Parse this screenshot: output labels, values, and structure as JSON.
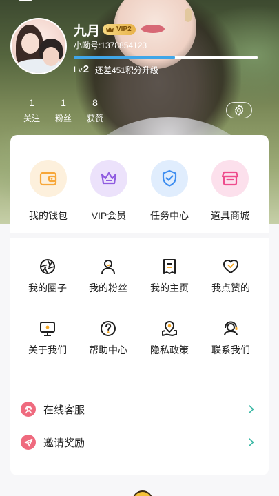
{
  "profile": {
    "username": "九月",
    "vip_label": "VIP2",
    "uid_text": "小呦号:1378854123",
    "level_prefix": "Lv",
    "level_number": "2",
    "level_progress": 0.55,
    "level_need_text": "还差451积分升级"
  },
  "stats": [
    {
      "value": "1",
      "label": "关注"
    },
    {
      "value": "1",
      "label": "粉丝"
    },
    {
      "value": "8",
      "label": "获赞"
    }
  ],
  "quick_actions": [
    {
      "label": "我的钱包",
      "icon": "wallet-icon",
      "color": "#f7a739",
      "bg": "#fdf0dc"
    },
    {
      "label": "VIP会员",
      "icon": "crown-icon",
      "color": "#8f5be0",
      "bg": "#ece2fb"
    },
    {
      "label": "任务中心",
      "icon": "shield-check-icon",
      "color": "#3f8ef0",
      "bg": "#e0edfd"
    },
    {
      "label": "道具商城",
      "icon": "store-icon",
      "color": "#ee4b8c",
      "bg": "#fce0ec"
    }
  ],
  "grid_items": [
    {
      "label": "我的圈子",
      "icon": "aperture-icon"
    },
    {
      "label": "我的粉丝",
      "icon": "person-icon"
    },
    {
      "label": "我的主页",
      "icon": "document-icon"
    },
    {
      "label": "我点赞的",
      "icon": "heart-icon"
    },
    {
      "label": "关于我们",
      "icon": "monitor-icon"
    },
    {
      "label": "帮助中心",
      "icon": "question-icon"
    },
    {
      "label": "隐私政策",
      "icon": "location-map-icon"
    },
    {
      "label": "联系我们",
      "icon": "headset-icon"
    }
  ],
  "list_items": [
    {
      "label": "在线客服",
      "icon": "headset-icon",
      "color": "#ef6a7e"
    },
    {
      "label": "邀请奖励",
      "icon": "send-icon",
      "color": "#ef6a7e"
    }
  ],
  "colors": {
    "accent_teal": "#3bb8a5",
    "icon_dark": "#1f1f1f",
    "level_bar": "#40a6e8"
  }
}
